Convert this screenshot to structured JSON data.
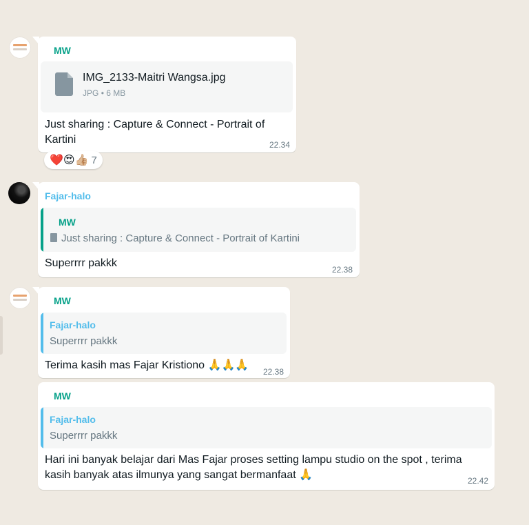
{
  "messages": {
    "m1": {
      "sender": "MW",
      "file_name": "IMG_2133-Maitri Wangsa.jpg",
      "file_type": "JPG",
      "file_size": "6 MB",
      "text_line1": "Just sharing : Capture & Connect - Portrait of",
      "text_line2": "Kartini",
      "time": "22.34",
      "reactions": "❤️😍👍🏼",
      "reaction_count": "7"
    },
    "m2": {
      "sender": "Fajar-halo",
      "quote_author": "MW",
      "quote_text": "Just sharing : Capture & Connect - Portrait of Kartini",
      "text": "Superrrr pakkk",
      "time": "22.38"
    },
    "m3": {
      "sender": "MW",
      "quote_author": "Fajar-halo",
      "quote_text": "Superrrr pakkk",
      "text": "Terima kasih mas Fajar Kristiono 🙏🙏🙏",
      "time": "22.38"
    },
    "m4": {
      "sender": "MW",
      "quote_author": "Fajar-halo",
      "quote_text": "Superrrr pakkk",
      "text_line1": "Hari ini banyak belajar dari Mas Fajar proses setting lampu studio on the spot , terima",
      "text_line2": "kasih banyak atas ilmunya yang sangat bermanfaat 🙏",
      "time": "22.42"
    }
  },
  "colors": {
    "background": "#efeae2",
    "mw_name": "#06a189",
    "fajar_name": "#53bdeb",
    "timestamp": "#667781"
  },
  "icons": [
    "document-icon",
    "avatar-logo",
    "avatar-dark"
  ]
}
